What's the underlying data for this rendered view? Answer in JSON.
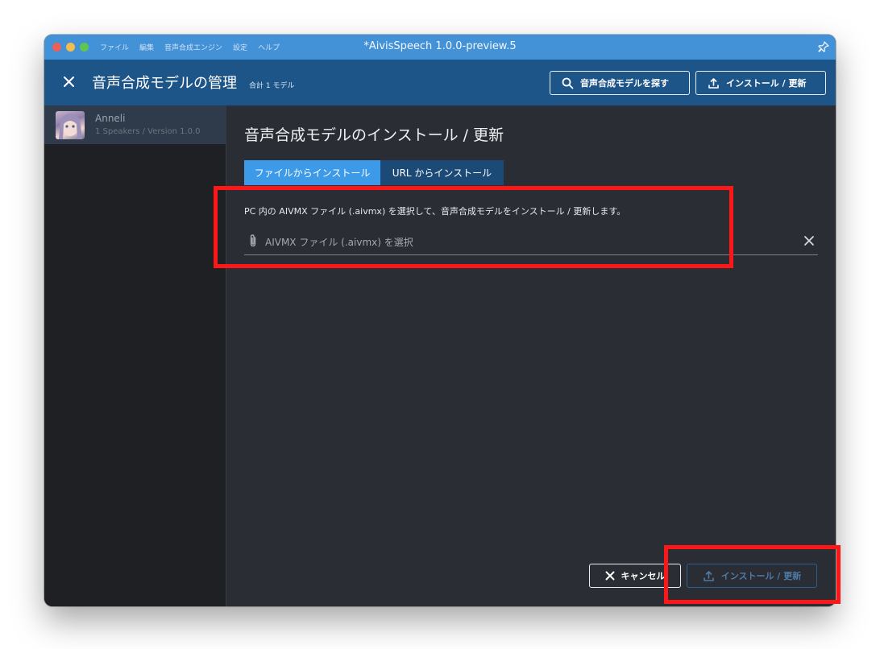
{
  "titlebar": {
    "menu": [
      "ファイル",
      "編集",
      "音声合成エンジン",
      "設定",
      "ヘルプ"
    ],
    "title": "*AivisSpeech 1.0.0-preview.5"
  },
  "header": {
    "title": "音声合成モデルの管理",
    "count": "合計 1 モデル",
    "find_label": "音声合成モデルを探す",
    "install_label": "インストール / 更新"
  },
  "sidebar": {
    "items": [
      {
        "name": "Anneli",
        "subtitle": "1 Speakers / Version 1.0.0"
      }
    ]
  },
  "main": {
    "title": "音声合成モデルのインストール / 更新",
    "tabs": [
      {
        "label": "ファイルからインストール",
        "selected": true
      },
      {
        "label": "URL からインストール",
        "selected": false
      }
    ],
    "description": "PC 内の AIVMX ファイル (.aivmx) を選択して、音声合成モデルをインストール / 更新します。",
    "file_placeholder": "AIVMX ファイル (.aivmx) を選択",
    "cancel_label": "キャンセル",
    "install_label": "インストール / 更新"
  },
  "colors": {
    "titlebar": "#4391d6",
    "header": "#1e5589",
    "tab_selected": "#3d9ae8",
    "tab_unselected": "#1c4a77",
    "annotation": "#ff1616"
  }
}
